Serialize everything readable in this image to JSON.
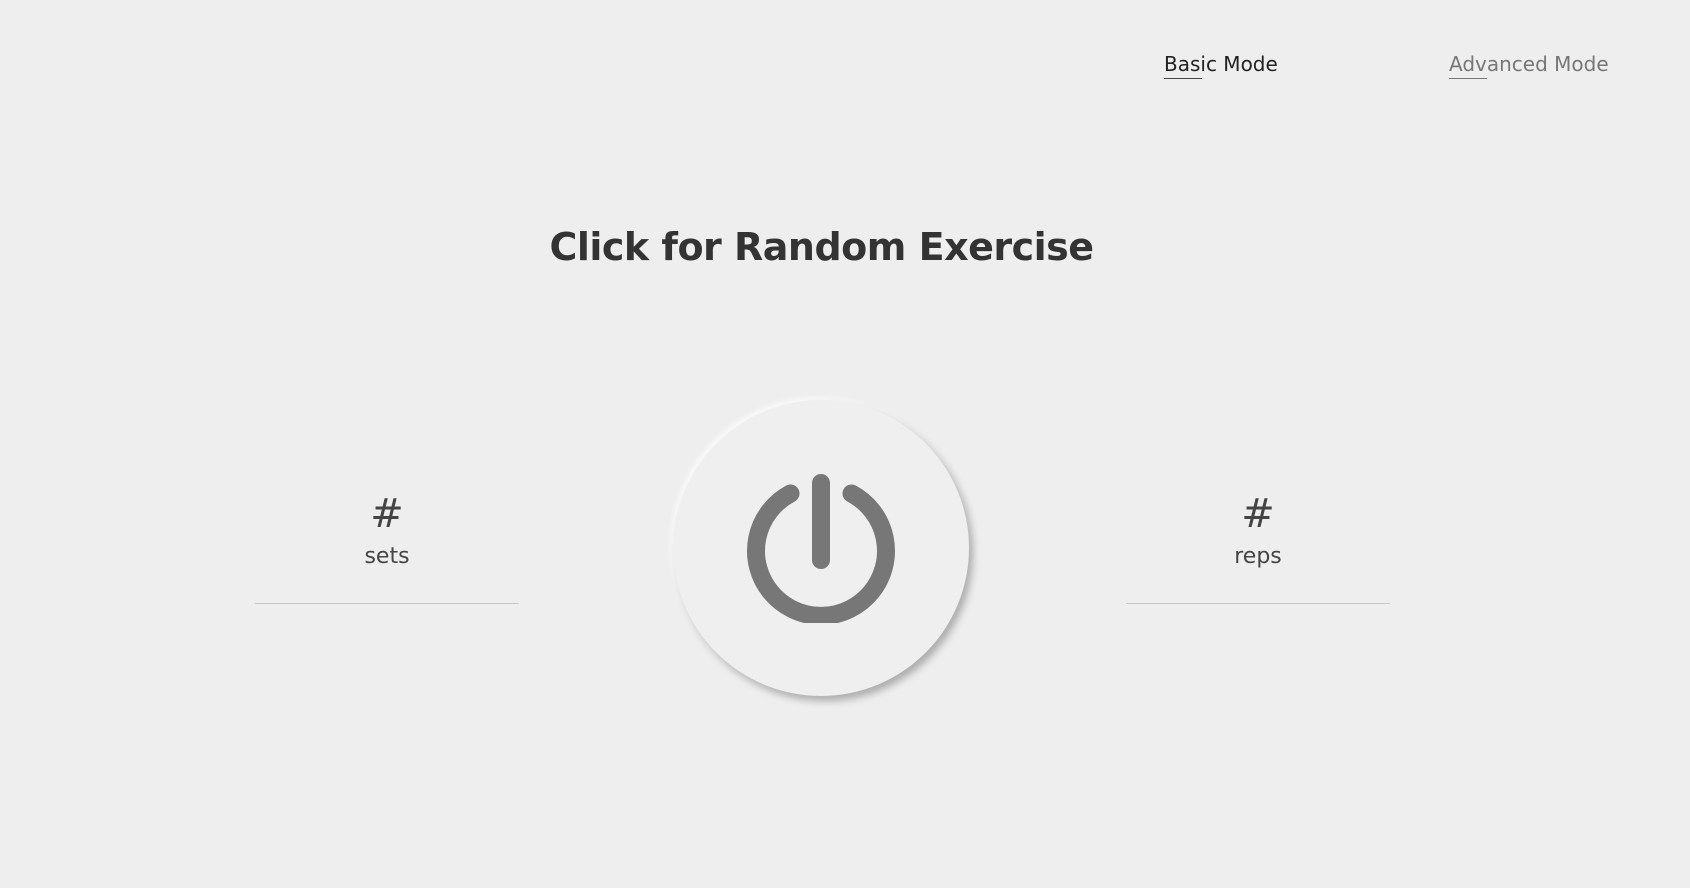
{
  "nav": {
    "basic_mode_label": "Basic Mode",
    "advanced_mode_label": "Advanced Mode",
    "active_mode": "Basic Mode"
  },
  "heading": "Click for Random Exercise",
  "counters": {
    "sets": {
      "value": "#",
      "label": "sets"
    },
    "reps": {
      "value": "#",
      "label": "reps"
    }
  },
  "power_button": {
    "icon": "power-icon",
    "icon_color": "#777777"
  },
  "colors": {
    "background": "#eeeeee",
    "text_dark": "#333333",
    "text_muted": "#777777"
  }
}
